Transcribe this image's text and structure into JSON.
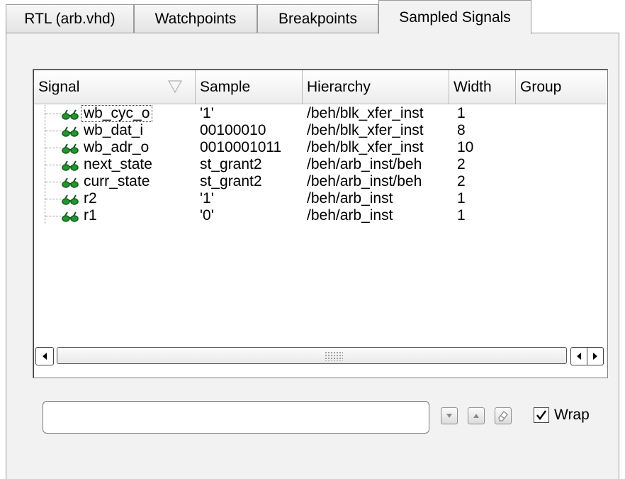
{
  "tabs": [
    {
      "label": "RTL (arb.vhd)",
      "active": false
    },
    {
      "label": "Watchpoints",
      "active": false
    },
    {
      "label": "Breakpoints",
      "active": false
    },
    {
      "label": "Sampled Signals",
      "active": true
    }
  ],
  "table": {
    "columns": [
      "Signal",
      "Sample",
      "Hierarchy",
      "Width",
      "Group"
    ],
    "sort_indicator": "sort-descending-icon",
    "rows": [
      {
        "signal": "wb_cyc_o",
        "sample": "'1'",
        "hierarchy": "/beh/blk_xfer_inst",
        "width": "1",
        "group": ""
      },
      {
        "signal": "wb_dat_i",
        "sample": "00100010",
        "hierarchy": "/beh/blk_xfer_inst",
        "width": "8",
        "group": ""
      },
      {
        "signal": "wb_adr_o",
        "sample": "0010001011",
        "hierarchy": "/beh/blk_xfer_inst",
        "width": "10",
        "group": ""
      },
      {
        "signal": "next_state",
        "sample": "st_grant2",
        "hierarchy": "/beh/arb_inst/beh",
        "width": "2",
        "group": ""
      },
      {
        "signal": "curr_state",
        "sample": "st_grant2",
        "hierarchy": "/beh/arb_inst/beh",
        "width": "2",
        "group": ""
      },
      {
        "signal": "r2",
        "sample": "'1'",
        "hierarchy": "/beh/arb_inst",
        "width": "1",
        "group": ""
      },
      {
        "signal": "r1",
        "sample": "'0'",
        "hierarchy": "/beh/arb_inst",
        "width": "1",
        "group": ""
      }
    ],
    "row_icon": "binoculars-icon"
  },
  "find": {
    "value": "",
    "placeholder": "",
    "wrap_label": "Wrap",
    "wrap_checked": true
  },
  "colors": {
    "glasses_green": "#1e9a2a",
    "panel": "#f2f2f2"
  }
}
